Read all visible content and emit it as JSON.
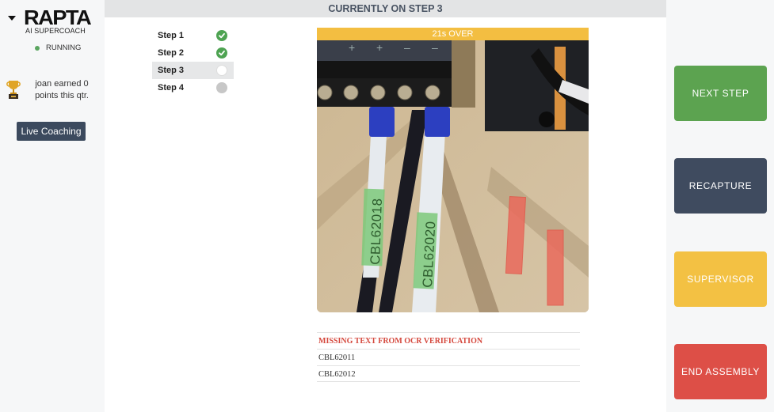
{
  "sidebar": {
    "brand": "RAPTA",
    "brand_subtitle": "AI SUPERCOACH",
    "status_label": "RUNNING",
    "status_color": "#5aa55f",
    "points_text": "joan earned 0 points this qtr.",
    "trophy_icon": "trophy-icon",
    "live_coaching_label": "Live Coaching"
  },
  "header": {
    "banner": "CURRENTLY ON STEP 3"
  },
  "steps": [
    {
      "label": "Step 1",
      "state": "complete"
    },
    {
      "label": "Step 2",
      "state": "complete"
    },
    {
      "label": "Step 3",
      "state": "current"
    },
    {
      "label": "Step 4",
      "state": "pending"
    }
  ],
  "timer": {
    "label": "21s OVER",
    "color": "#f3be41"
  },
  "photo": {
    "detected_labels": [
      "CBL62018",
      "CBL62020"
    ],
    "missing_marker_count": 2
  },
  "ocr_verification": {
    "heading": "MISSING TEXT FROM OCR VERIFICATION",
    "items": [
      "CBL62011",
      "CBL62012"
    ]
  },
  "actions": [
    {
      "label": "NEXT STEP",
      "color": "#5ca350"
    },
    {
      "label": "RECAPTURE",
      "color": "#3f4b5f"
    },
    {
      "label": "SUPERVISOR",
      "color": "#f3c143"
    },
    {
      "label": "END ASSEMBLY",
      "color": "#dd4f47"
    }
  ]
}
